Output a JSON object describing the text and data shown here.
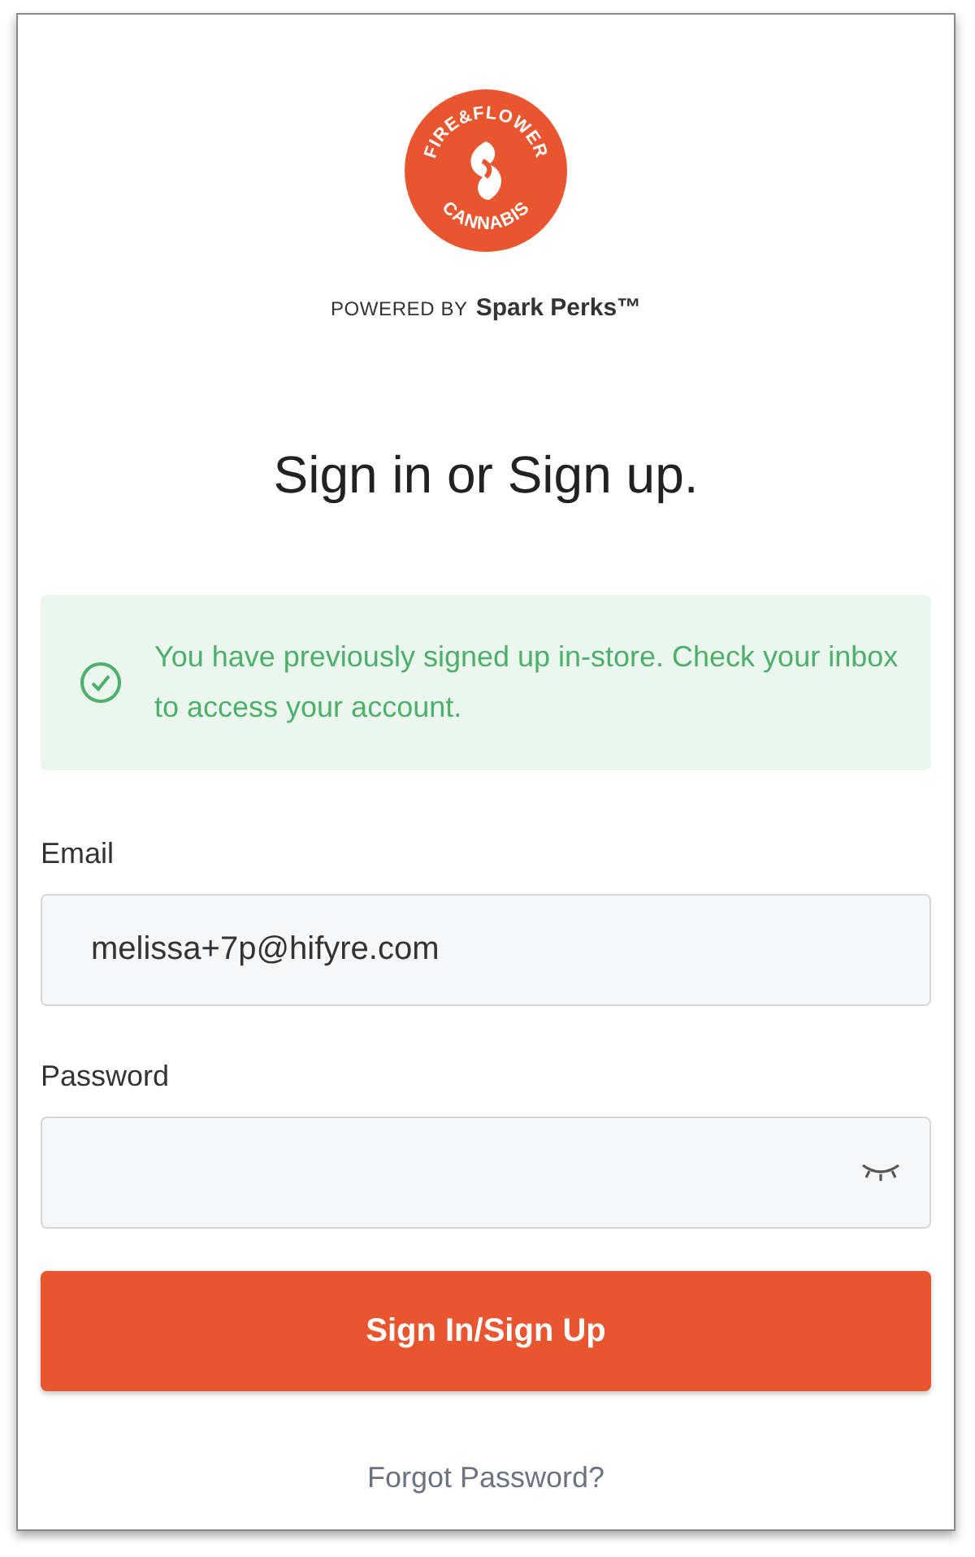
{
  "logo": {
    "top_text": "FIRE&FLOWER",
    "bottom_text": "CANNABIS"
  },
  "powered_by": {
    "prefix": "POWERED BY",
    "brand": "Spark Perks™"
  },
  "heading": "Sign in or Sign up.",
  "alert": {
    "kind": "success",
    "message": "You have previously signed up in-store. Check your inbox to access your account."
  },
  "fields": [
    {
      "label": "Email",
      "kind": "text",
      "value": "melissa+7p@hifyre.com"
    },
    {
      "label": "Password",
      "kind": "password"
    }
  ],
  "submit": "Sign In/Sign Up",
  "forgot_link": "Forgot Password?"
}
